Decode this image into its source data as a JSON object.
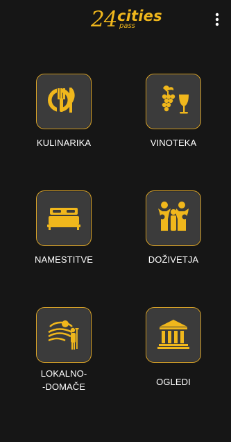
{
  "app": {
    "logo": {
      "number": "24",
      "word": "cities",
      "sub": "pass"
    },
    "menu_icon": "more-vertical-icon"
  },
  "categories": [
    {
      "label": "KULINARIKA",
      "icon": "dining-icon"
    },
    {
      "label": "VINOTEKA",
      "icon": "wine-icon"
    },
    {
      "label": "NAMESTITVE",
      "icon": "bed-icon"
    },
    {
      "label": "DOŽIVETJA",
      "icon": "family-icon"
    },
    {
      "label_lines": [
        "LOKALNO-",
        "-DOMAČE"
      ],
      "icon": "farmer-icon"
    },
    {
      "label": "OGLEDI",
      "icon": "museum-icon"
    }
  ],
  "colors": {
    "background": "#161616",
    "accent": "#f0b71c",
    "tile": "#3b3b3b",
    "text": "#ffffff"
  }
}
